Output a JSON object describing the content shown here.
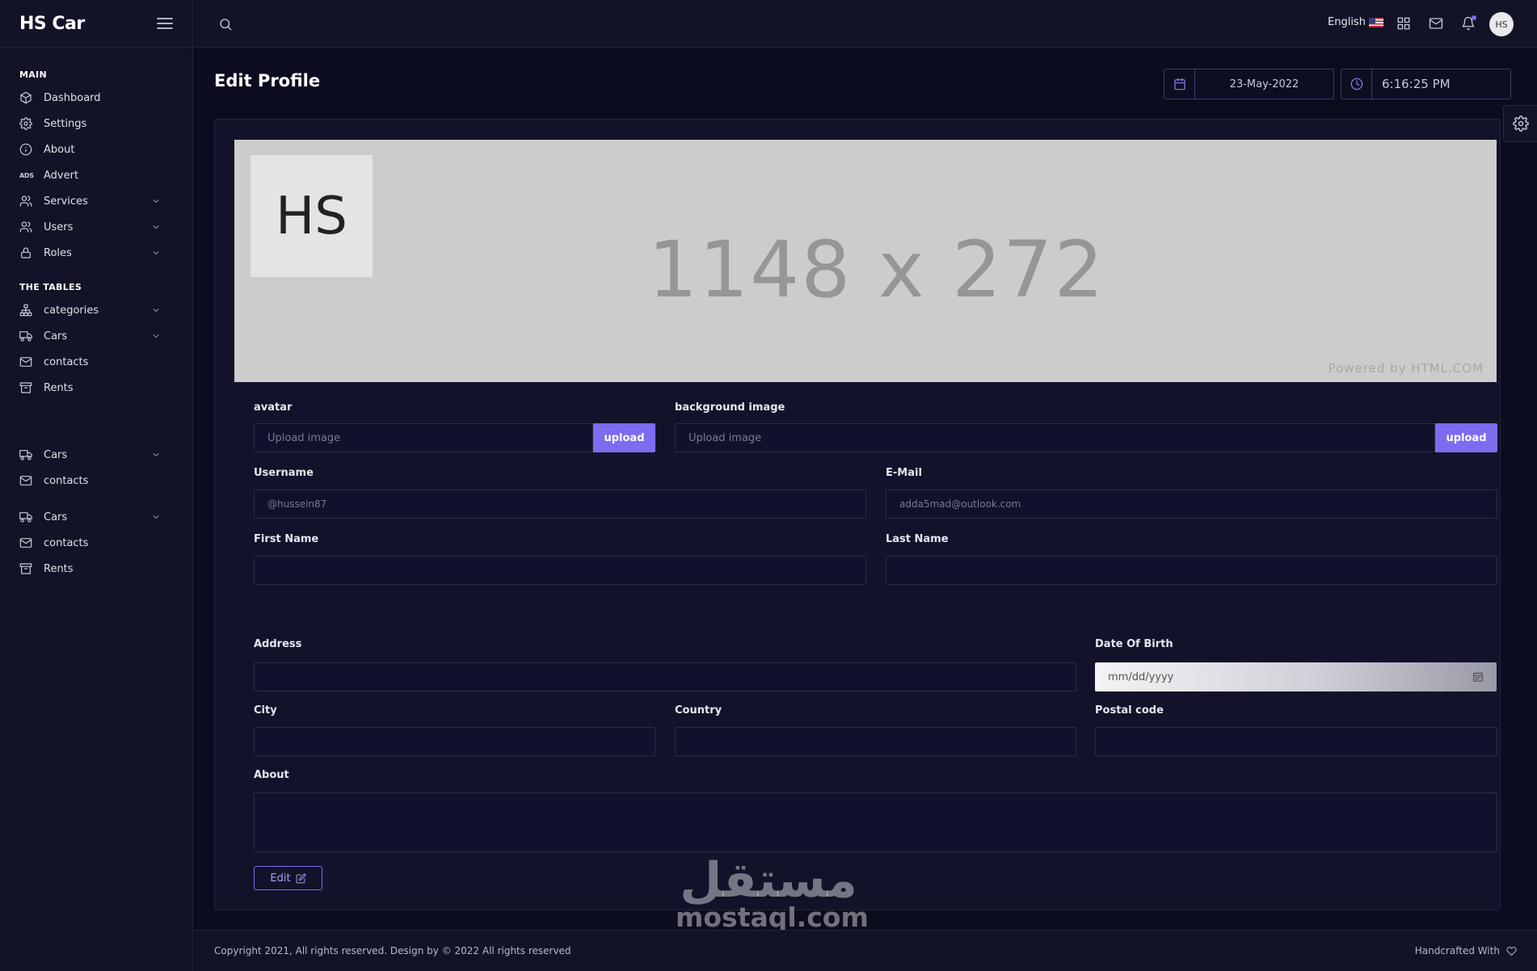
{
  "sidebar": {
    "brand": "HS Car",
    "sections": {
      "main": "MAIN",
      "tables": "THE TABLES"
    },
    "items": {
      "dashboard": "Dashboard",
      "settings": "Settings",
      "about": "About",
      "ads_label": "ADS",
      "advert": "Advert",
      "services": "Services",
      "users": "Users",
      "roles": "Roles",
      "categories": "categories",
      "cars": "Cars",
      "contacts": "contacts",
      "rents": "Rents"
    }
  },
  "topbar": {
    "language": "English",
    "avatar_initials": "HS"
  },
  "page": {
    "title": "Edit Profile",
    "date": "23-May-2022",
    "time": "6:16:25 PM"
  },
  "banner": {
    "size_text": "1148 x 272",
    "powered": "Powered by HTML.COM",
    "avatar_text": "HS"
  },
  "form": {
    "avatar_label": "avatar",
    "background_label": "background image",
    "upload_placeholder": "Upload image",
    "upload_button": "upload",
    "username_label": "Username",
    "username_placeholder": "@hussein87",
    "email_label": "E-Mail",
    "email_placeholder": "adda5mad@outlook.com",
    "first_name_label": "First Name",
    "last_name_label": "Last Name",
    "address_label": "Address",
    "dob_label": "Date Of Birth",
    "dob_placeholder": "mm/dd/yyyy",
    "city_label": "City",
    "country_label": "Country",
    "postal_label": "Postal code",
    "about_label": "About",
    "edit_button": "Edit"
  },
  "footer": {
    "copyright": "Copyright 2021, All rights reserved. Design by © 2022 All rights reserved",
    "handcrafted": "Handcrafted With"
  },
  "watermark": {
    "arabic": "مستقل",
    "latin": "mostaql.com"
  },
  "colors": {
    "accent": "#7c6cf0",
    "background": "#0b0c1d",
    "sidebar": "#121326"
  }
}
